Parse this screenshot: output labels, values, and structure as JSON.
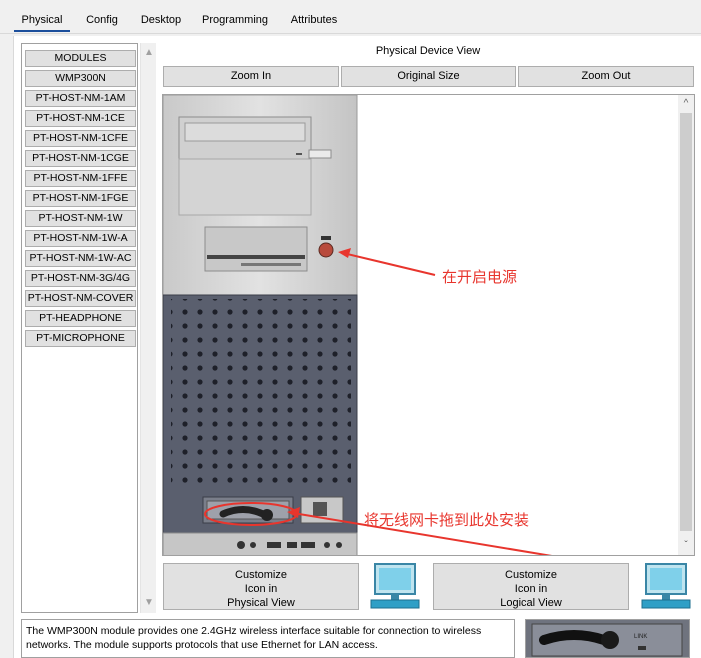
{
  "tabs": [
    {
      "label": "Physical",
      "active": true
    },
    {
      "label": "Config"
    },
    {
      "label": "Desktop"
    },
    {
      "label": "Programming"
    },
    {
      "label": "Attributes"
    }
  ],
  "modules": [
    "MODULES",
    "WMP300N",
    "PT-HOST-NM-1AM",
    "PT-HOST-NM-1CE",
    "PT-HOST-NM-1CFE",
    "PT-HOST-NM-1CGE",
    "PT-HOST-NM-1FFE",
    "PT-HOST-NM-1FGE",
    "PT-HOST-NM-1W",
    "PT-HOST-NM-1W-A",
    "PT-HOST-NM-1W-AC",
    "PT-HOST-NM-3G/4G",
    "PT-HOST-NM-COVER",
    "PT-HEADPHONE",
    "PT-MICROPHONE"
  ],
  "physical_view": {
    "title": "Physical Device View",
    "zoom_in": "Zoom In",
    "original_size": "Original Size",
    "zoom_out": "Zoom Out"
  },
  "annotations": {
    "power": "在开启电源",
    "install": "将无线网卡拖到此处安装"
  },
  "customize_physical": [
    "Customize",
    "Icon in",
    "Physical View"
  ],
  "customize_logical": [
    "Customize",
    "Icon in",
    "Logical View"
  ],
  "description": "The WMP300N module provides one 2.4GHz wireless interface suitable for connection to wireless networks. The module supports protocols that use Ethernet for LAN access.",
  "module_label": "LINK",
  "colors": {
    "accent": "#1c4f9c",
    "annotation": "#e8352d",
    "case_light": "#d7d7d7",
    "case_dark": "#5a5f6e"
  }
}
